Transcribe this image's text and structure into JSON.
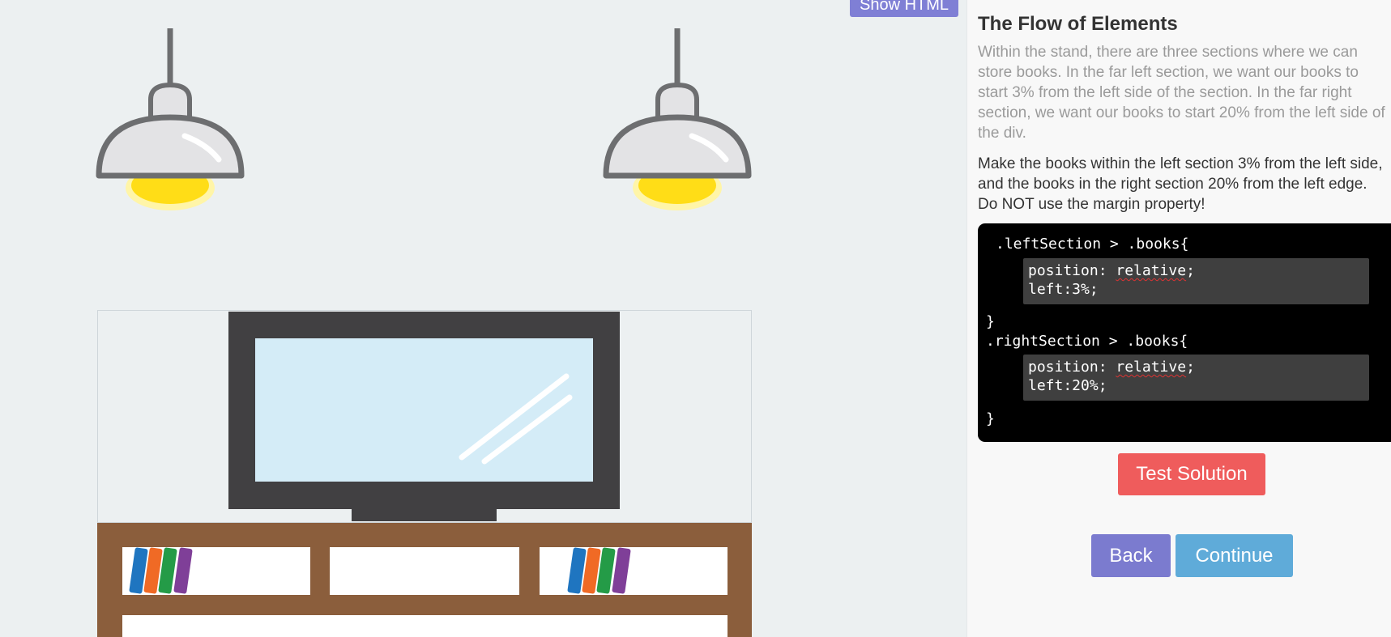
{
  "toolbar": {
    "show_html_label": "Show HTML"
  },
  "lesson": {
    "title": "The Flow of Elements",
    "description": "Within the stand, there are three sections where we can store books. In the far left section, we want our books to start 3% from the left side of the section. In the far right section, we want our books to start 20% from the left side of the div.",
    "instruction": "Make the books within the left section 3% from the left side, and the books in the right section 20% from the left edge. Do NOT use the margin property!"
  },
  "code": {
    "left_selector": ".leftSection > .books{",
    "left_prop_name": "position: ",
    "left_prop_value": "relative",
    "left_prop_end": ";",
    "left_offset": "left:3%;",
    "left_close": "}",
    "right_selector": ".rightSection > .books{",
    "right_prop_name": "position: ",
    "right_prop_value": "relative",
    "right_prop_end": ";",
    "right_offset": "left:20%;",
    "right_close": "}"
  },
  "buttons": {
    "test": "Test Solution",
    "back": "Back",
    "continue": "Continue"
  },
  "colors": {
    "lamp_gray": "#6d6e70",
    "lamp_shade": "#e3e3e5",
    "bulb": "#ffdd17",
    "tv_frame": "#414042",
    "tv_screen": "#d4ecf7",
    "stand_wood": "#8b5e3c",
    "book_blue": "#1f75c0",
    "book_orange": "#f06a25",
    "book_green": "#249b47",
    "book_purple": "#7f3f98",
    "test_button": "#ef5c5c",
    "back_button": "#7b7bcf",
    "continue_button": "#5fabd9"
  },
  "icons": [
    "pendant-lamp-icon",
    "television-icon",
    "book-icon"
  ]
}
